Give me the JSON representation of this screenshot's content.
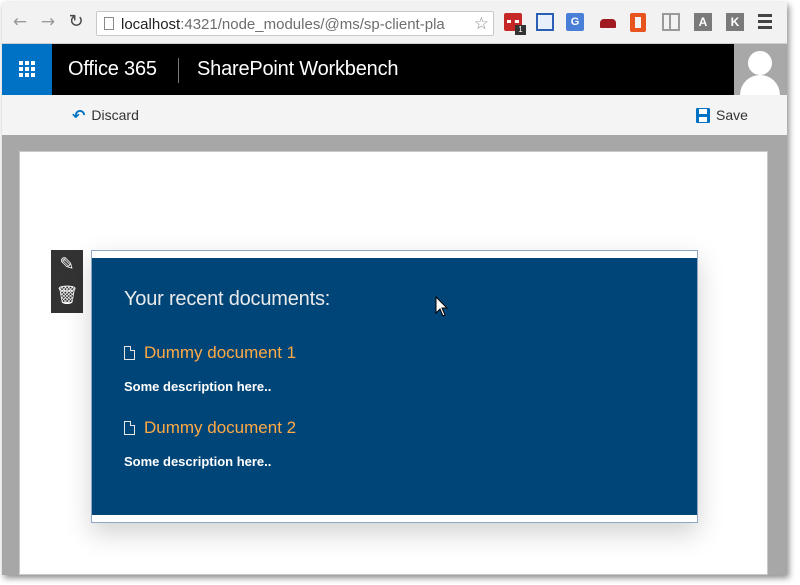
{
  "browser": {
    "url_host": "localhost",
    "url_path": ":4321/node_modules/@ms/sp-client-pla",
    "extension_badge": "1",
    "ext_translate_label": "G",
    "ext_a_label": "A",
    "ext_k_label": "K"
  },
  "suitebar": {
    "brand": "Office 365",
    "app_title": "SharePoint Workbench"
  },
  "commandbar": {
    "discard_label": "Discard",
    "save_label": "Save"
  },
  "webpart": {
    "title": "Your recent documents:",
    "documents": [
      {
        "name": "Dummy document 1",
        "description": "Some description here.."
      },
      {
        "name": "Dummy document 2",
        "description": "Some description here.."
      }
    ]
  },
  "colors": {
    "waffle": "#0072c6",
    "webpart_bg": "#004578",
    "doc_link": "#ffaa44",
    "suitebar_bg": "#000000"
  },
  "icons": {
    "back": "arrow-left-icon",
    "forward": "arrow-right-icon",
    "reload": "reload-icon",
    "bookmark": "star-icon",
    "waffle": "app-launcher-icon",
    "discard": "undo-icon",
    "save": "floppy-disk-icon",
    "edit": "pencil-icon",
    "delete": "trash-icon",
    "document": "document-icon"
  }
}
